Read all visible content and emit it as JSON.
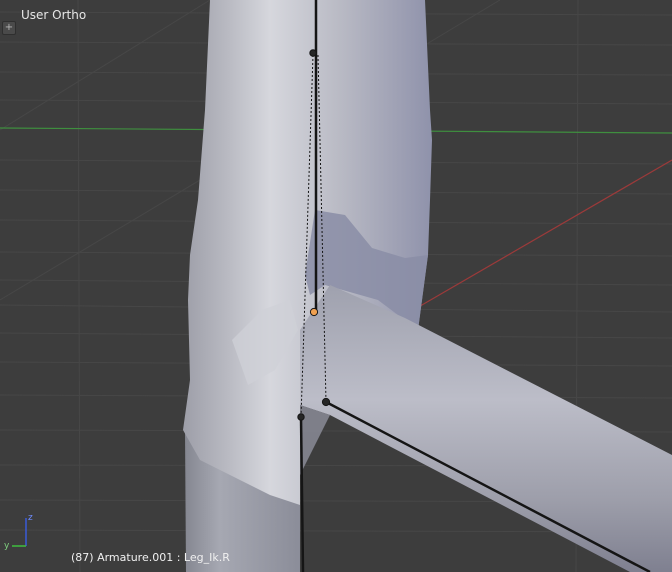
{
  "viewport": {
    "view_label": "User Ortho",
    "info_text": "(87) Armature.001 : Leg_Ik.R",
    "add_button_glyph": "+",
    "axis_labels": {
      "z": "z",
      "y": "y"
    }
  },
  "colors": {
    "background": "#3d3d3d",
    "grid": "#474747",
    "x_axis": "#9b3a3a",
    "y_axis": "#3f8f3f",
    "mesh": "#9ea0ad",
    "bone_active": "#f0a050",
    "bone": "#151515"
  }
}
